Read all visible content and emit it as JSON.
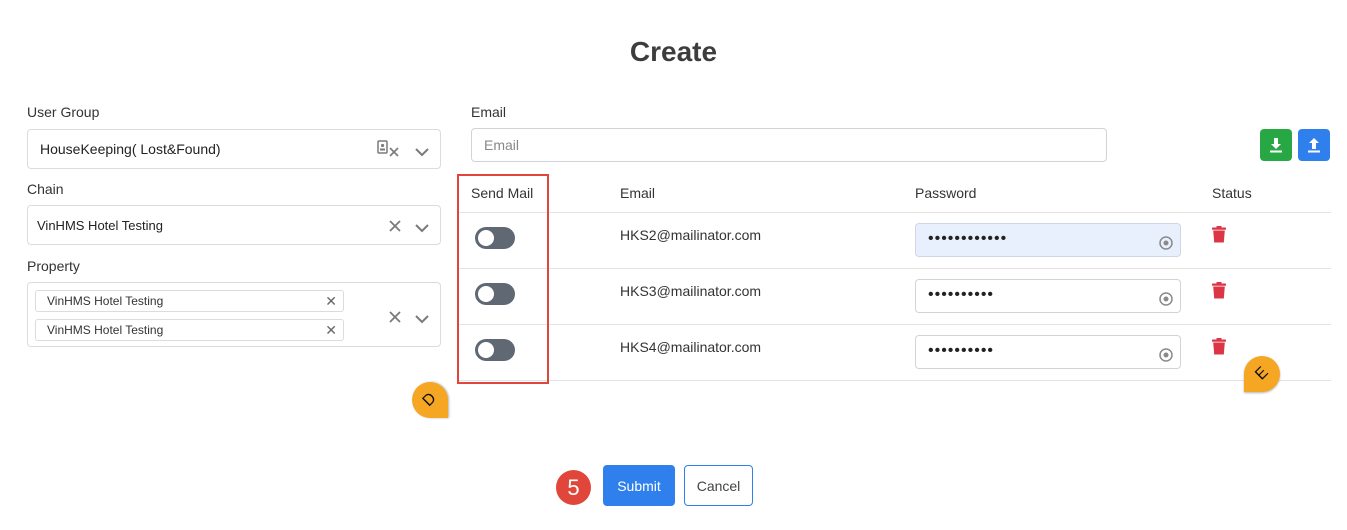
{
  "page": {
    "title": "Create"
  },
  "form": {
    "user_group": {
      "label": "User Group",
      "value": "HouseKeeping( Lost&Found)"
    },
    "chain": {
      "label": "Chain",
      "value": "VinHMS Hotel Testing"
    },
    "property": {
      "label": "Property",
      "chips": [
        "VinHMS Hotel Testing",
        "VinHMS Hotel Testing"
      ]
    },
    "email": {
      "label": "Email",
      "placeholder": "Email",
      "value": ""
    }
  },
  "table": {
    "headers": {
      "send_mail": "Send Mail",
      "email": "Email",
      "password": "Password",
      "status": "Status"
    },
    "rows": [
      {
        "send_mail": false,
        "email": "HKS2@mailinator.com",
        "password_mask": "••••••••••••"
      },
      {
        "send_mail": false,
        "email": "HKS3@mailinator.com",
        "password_mask": "••••••••••"
      },
      {
        "send_mail": false,
        "email": "HKS4@mailinator.com",
        "password_mask": "••••••••••"
      }
    ]
  },
  "annotations": {
    "marker_d": "D",
    "marker_e": "E",
    "step_number": "5"
  },
  "actions": {
    "submit_label": "Submit",
    "cancel_label": "Cancel"
  },
  "colors": {
    "primary": "#2f80ed",
    "download": "#28a745",
    "delete": "#dc3545",
    "annotation_box": "#e0463a",
    "marker": "#f5a623",
    "toggle_off": "#5f6873"
  },
  "icons": {
    "download": "download-icon",
    "upload": "upload-icon",
    "delete": "trash-icon",
    "password_reveal": "eye-icon",
    "clear": "close-icon",
    "dropdown": "chevron-down-icon"
  }
}
